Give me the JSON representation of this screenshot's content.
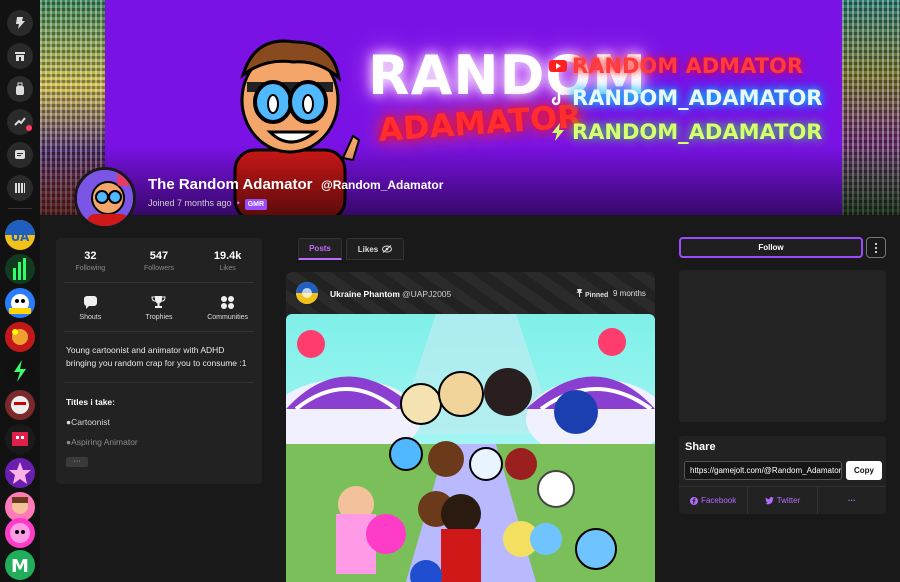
{
  "profile": {
    "display_name": "The Random Adamator",
    "handle": "@Random_Adamator",
    "joined": "Joined 7 months ago",
    "badge": "GMR",
    "banner": {
      "headline": "RANDOM",
      "subheadline": "ADAMATOR",
      "socials": [
        {
          "icon": "youtube-icon",
          "label": "RANDOM ADMATOR"
        },
        {
          "icon": "tiktok-icon",
          "label": "RANDOM_ADAMATOR"
        },
        {
          "icon": "gamejolt-icon",
          "label": "RANDOM_ADAMATOR"
        }
      ]
    }
  },
  "stats": [
    {
      "value": "32",
      "label": "Following"
    },
    {
      "value": "547",
      "label": "Followers"
    },
    {
      "value": "19.4k",
      "label": "Likes"
    }
  ],
  "links": [
    {
      "icon": "chat-bubble-icon",
      "label": "Shouts"
    },
    {
      "icon": "trophy-icon",
      "label": "Trophies"
    },
    {
      "icon": "communities-icon",
      "label": "Communities"
    }
  ],
  "bio": {
    "text": "Young cartoonist and animator with ADHD bringing you random crap for you to consume :1",
    "titles_heading": "Titles i take:",
    "titles": [
      "●Cartoonist",
      "●Aspiring Animator"
    ],
    "more_label": "···"
  },
  "tabs": {
    "posts": "Posts",
    "likes": "Likes"
  },
  "post": {
    "author_name": "Ukraine Phantom",
    "author_handle": "@UAPJ2005",
    "pinned_label": "Pinned",
    "time": "9 months"
  },
  "actions": {
    "follow": "Follow"
  },
  "share": {
    "title": "Share",
    "url": "https://gamejolt.com/@Random_Adamator",
    "copy": "Copy",
    "facebook": "Facebook",
    "twitter": "Twitter",
    "more": "···"
  },
  "colors": {
    "accent": "#9a4bff",
    "banner_bg": "#7a12e6",
    "page_bg": "#191919"
  }
}
